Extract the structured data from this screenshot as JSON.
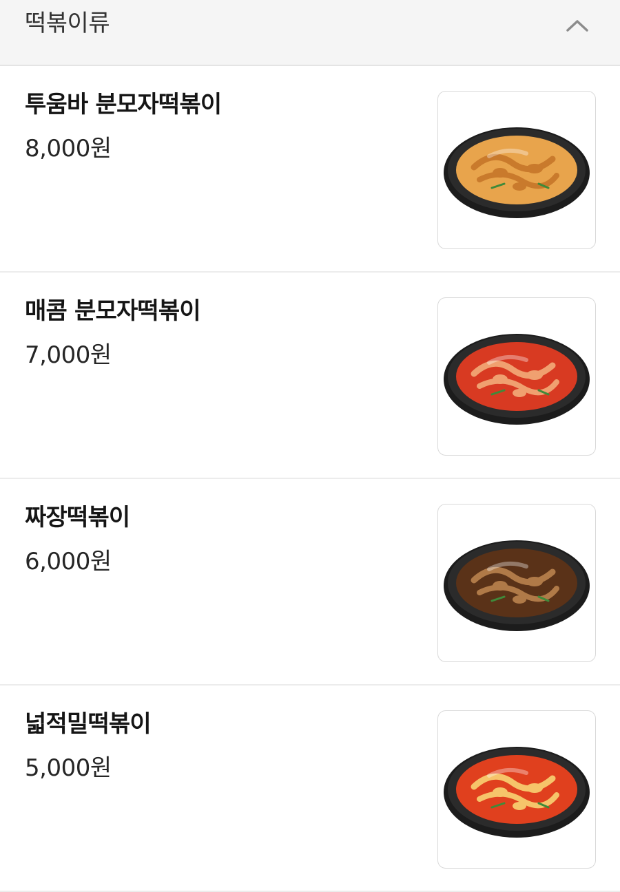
{
  "category": {
    "title": "떡볶이류",
    "collapse_icon": "chevron-up-icon"
  },
  "menu_items": [
    {
      "name": "투움바 분모자떡볶이",
      "price": "8,000원",
      "image_icon": "tteokbokki-image",
      "sauce_color": "#e8a44c",
      "accent_color": "#c97a2c"
    },
    {
      "name": "매콤 분모자떡볶이",
      "price": "7,000원",
      "image_icon": "tteokbokki-image",
      "sauce_color": "#d83a22",
      "accent_color": "#f0a070"
    },
    {
      "name": "짜장떡볶이",
      "price": "6,000원",
      "image_icon": "tteokbokki-image",
      "sauce_color": "#5a3218",
      "accent_color": "#b07a48"
    },
    {
      "name": "넓적밀떡볶이",
      "price": "5,000원",
      "image_icon": "tteokbokki-image",
      "sauce_color": "#e0401e",
      "accent_color": "#f6c46a"
    }
  ]
}
